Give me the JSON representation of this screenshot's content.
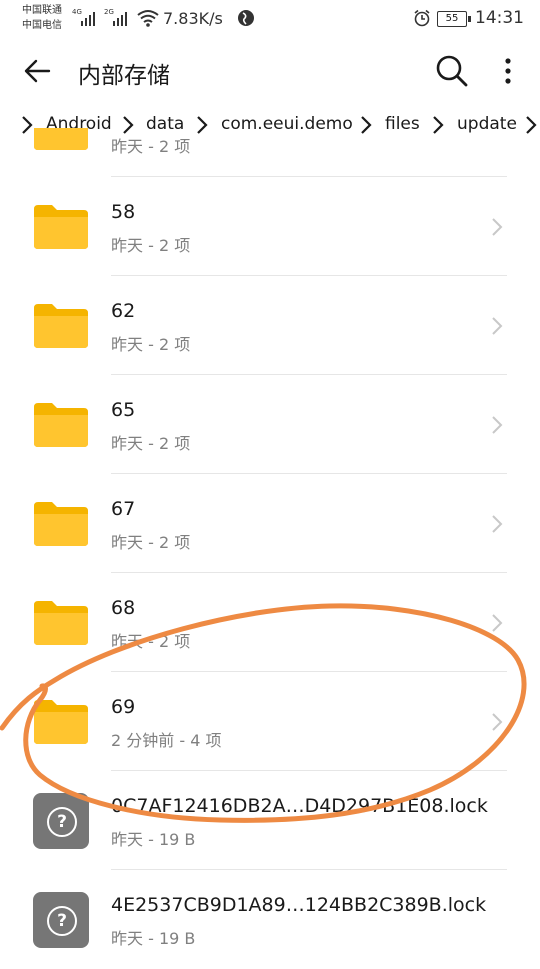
{
  "status_bar": {
    "carrier_1": "中国联通",
    "carrier_2": "中国电信",
    "net_1": "4G",
    "net_2": "2G",
    "speed": "7.83K/s",
    "battery": "55",
    "time": "14:31"
  },
  "app_bar": {
    "back_icon": "arrow-left-icon",
    "title": "内部存储",
    "search_icon": "search-icon",
    "more_icon": "more-vert-icon"
  },
  "breadcrumb": [
    "Android",
    "data",
    "com.eeui.demo",
    "files",
    "update"
  ],
  "items": [
    {
      "name": "",
      "meta": "昨天 - 2 项",
      "type": "folder"
    },
    {
      "name": "58",
      "meta": "昨天 - 2 项",
      "type": "folder"
    },
    {
      "name": "62",
      "meta": "昨天 - 2 项",
      "type": "folder"
    },
    {
      "name": "65",
      "meta": "昨天 - 2 项",
      "type": "folder"
    },
    {
      "name": "67",
      "meta": "昨天 - 2 项",
      "type": "folder"
    },
    {
      "name": "68",
      "meta": "昨天 - 2 项",
      "type": "folder"
    },
    {
      "name": "69",
      "meta": "2 分钟前 - 4 项",
      "type": "folder"
    },
    {
      "name": "0C7AF12416DB2A…D4D297B1E08.lock",
      "meta": "昨天 - 19 B",
      "type": "file"
    },
    {
      "name": "4E2537CB9D1A89…124BB2C389B.lock",
      "meta": "昨天 - 19 B",
      "type": "file"
    }
  ],
  "colors": {
    "folder": "#FFC52F",
    "folder_dark": "#F5B400",
    "annotation": "#EE8A43",
    "file_icon": "#767676"
  }
}
